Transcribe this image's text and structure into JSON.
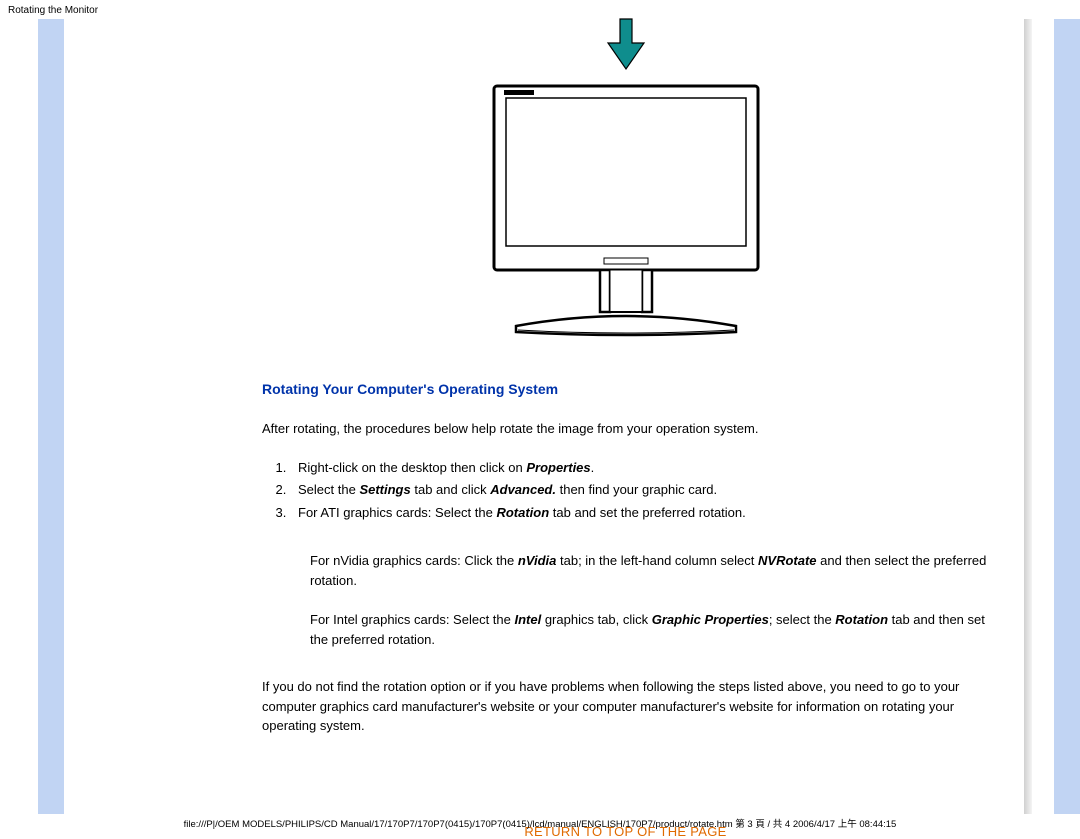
{
  "header": {
    "title": "Rotating the Monitor"
  },
  "section": {
    "heading": "Rotating Your Computer's Operating System"
  },
  "intro": "After rotating, the procedures below help rotate the image from your operation system.",
  "steps": {
    "s1a": "Right-click on the desktop then click on ",
    "s1b": "Properties",
    "s1c": ".",
    "s2a": "Select the ",
    "s2b": "Settings",
    "s2c": " tab and click ",
    "s2d": "Advanced.",
    "s2e": " then find your graphic card.",
    "s3a": "For ATI graphics cards: Select the ",
    "s3b": "Rotation",
    "s3c": " tab and set the preferred rotation."
  },
  "nvidia": {
    "a": "For nVidia graphics cards: Click the ",
    "b": "nVidia",
    "c": " tab; in the left-hand column select ",
    "d": "NVRotate",
    "e": " and then select the preferred rotation."
  },
  "intel": {
    "a": "For Intel graphics cards: Select the ",
    "b": "Intel",
    "c": " graphics tab, click ",
    "d": "Graphic Properties",
    "e": "; select the ",
    "f": "Rotation",
    "g": " tab and then set the preferred rotation."
  },
  "closing": "If you do not find the rotation option or if you have problems when following the steps listed above, you need to go to your computer graphics card manufacturer's website or your computer manufacturer's website for information on rotating your operating system.",
  "returnlink": "RETURN TO TOP OF THE PAGE",
  "footer": "file:///P|/OEM MODELS/PHILIPS/CD Manual/17/170P7/170P7(0415)/170P7(0415)/lcd/manual/ENGLISH/170P7/product/rotate.htm 第 3 頁 / 共 4 2006/4/17 上午 08:44:15"
}
